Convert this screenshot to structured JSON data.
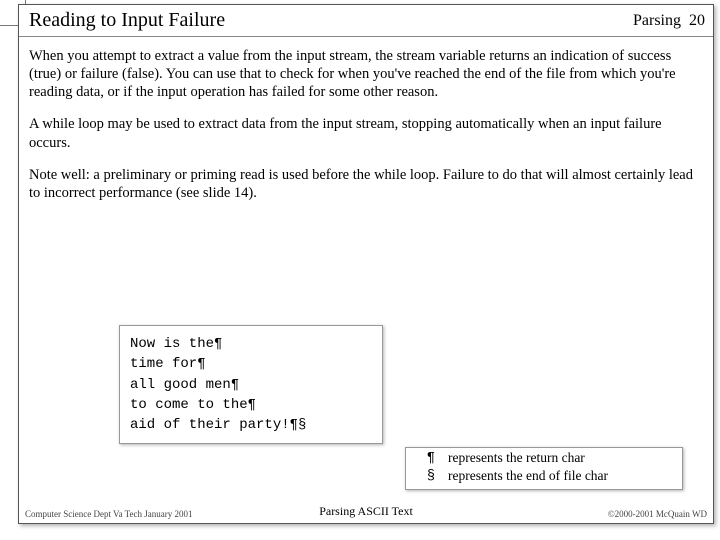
{
  "header": {
    "title": "Reading to Input Failure",
    "section": "Parsing",
    "page": "20"
  },
  "paragraphs": {
    "p1": "When you attempt to extract a value from the input stream, the stream variable returns an indication of success (true) or failure (false).  You can use that to check for when you've reached the end of the file from which you're reading data, or if the input operation has failed for some other reason.",
    "p2": "A while loop may be used to extract data from the input stream, stopping automatically when an input failure occurs.",
    "p3": "Note well:  a preliminary or priming read is used before the while loop.  Failure to do that will almost certainly lead to incorrect performance (see slide 14)."
  },
  "code": {
    "l1": "Now is the¶",
    "l2": "time for¶",
    "l3": "all good men¶",
    "l4": "to come to the¶",
    "l5": "aid of their party!¶§"
  },
  "legend": {
    "sym1": "¶",
    "txt1": "represents the return char",
    "sym2": "§",
    "txt2": "represents the end of file char"
  },
  "footer": {
    "left": "Computer Science Dept Va Tech January 2001",
    "center": "Parsing ASCII Text",
    "right": "©2000-2001  McQuain WD"
  }
}
